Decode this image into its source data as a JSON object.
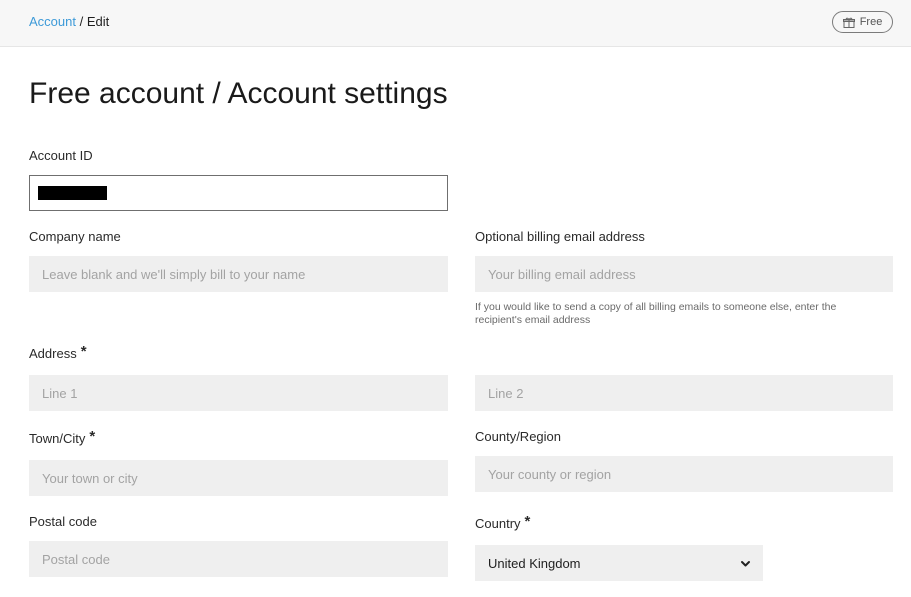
{
  "breadcrumb": {
    "parent": "Account",
    "separator": "/",
    "current": "Edit"
  },
  "plan_badge": {
    "icon": "gift-icon",
    "label": "Free"
  },
  "page_title": "Free account / Account settings",
  "required_marker": "*",
  "form": {
    "account_id": {
      "label": "Account ID",
      "value": ""
    },
    "company_name": {
      "label": "Company name",
      "placeholder": "Leave blank and we'll simply bill to your name"
    },
    "billing_email": {
      "label": "Optional billing email address",
      "placeholder": "Your billing email address",
      "help": "If you would like to send a copy of all billing emails to someone else, enter the recipient's email address"
    },
    "address": {
      "label": "Address",
      "line1_placeholder": "Line 1",
      "line2_placeholder": "Line 2"
    },
    "town": {
      "label": "Town/City",
      "placeholder": "Your town or city"
    },
    "county": {
      "label": "County/Region",
      "placeholder": "Your county or region"
    },
    "postal_code": {
      "label": "Postal code",
      "placeholder": "Postal code"
    },
    "country": {
      "label": "Country",
      "value": "United Kingdom",
      "icon": "chevron-down-icon"
    }
  }
}
